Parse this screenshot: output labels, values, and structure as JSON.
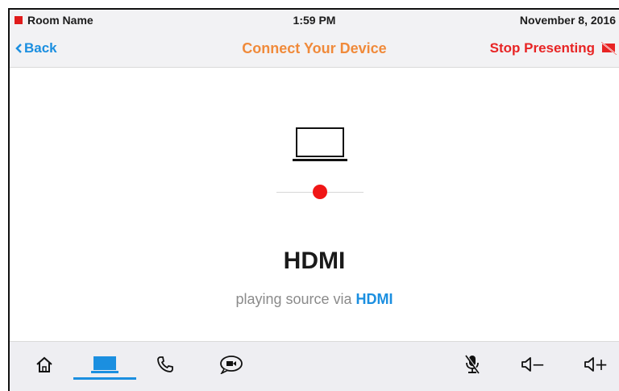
{
  "status_bar": {
    "room_name": "Room Name",
    "time": "1:59 PM",
    "date": "November 8, 2016",
    "room_indicator_color": "#e01b1b"
  },
  "nav": {
    "back_label": "Back",
    "title": "Connect Your Device",
    "stop_label": "Stop Presenting"
  },
  "content": {
    "source_name": "HDMI",
    "subtitle_prefix": "playing source via ",
    "subtitle_source": "HDMI"
  },
  "bottom_bar": {
    "items": [
      {
        "icon": "home-icon"
      },
      {
        "icon": "laptop-icon",
        "active": true
      },
      {
        "icon": "phone-icon"
      },
      {
        "icon": "video-chat-icon"
      },
      {
        "icon": "mic-muted-icon"
      },
      {
        "icon": "volume-down-icon",
        "glyph": "−"
      },
      {
        "icon": "volume-up-icon",
        "glyph": "+"
      }
    ]
  },
  "colors": {
    "accent_blue": "#1b8fe0",
    "title_orange": "#f08a3a",
    "stop_red": "#e82424"
  }
}
